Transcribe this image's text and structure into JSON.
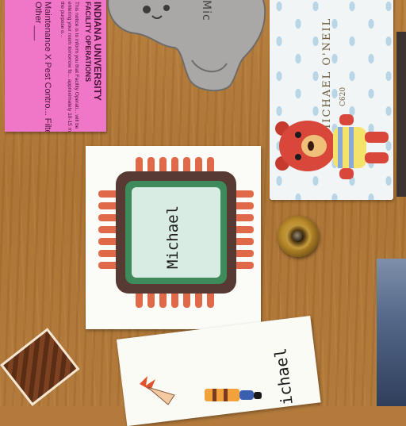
{
  "notice": {
    "line1": "INDIANA UNIVERSITY",
    "line2": "FACILITY OPERATIONS",
    "body": "This notice is to inform you that Facility Operati... will be entering your room tomorrow fo... approximately 10-15 min for the purpose o...",
    "checks": "Maintenance X   Pest Contro...   Filter X   Other ___"
  },
  "elephant": {
    "text": "Mic"
  },
  "villager_card": {
    "name": "MICHAEL O'NEIL",
    "sub": "C620"
  },
  "chip_sticker": {
    "name": "Michael"
  },
  "phineas_card": {
    "text": "ichael"
  },
  "colors": {
    "door": "#b37a3c",
    "notice_pink": "#f077c8",
    "chip_body": "#563a33",
    "chip_pins": "#e0694a",
    "chip_inner_green": "#3e8a5a",
    "chip_core": "#d9ece4"
  }
}
